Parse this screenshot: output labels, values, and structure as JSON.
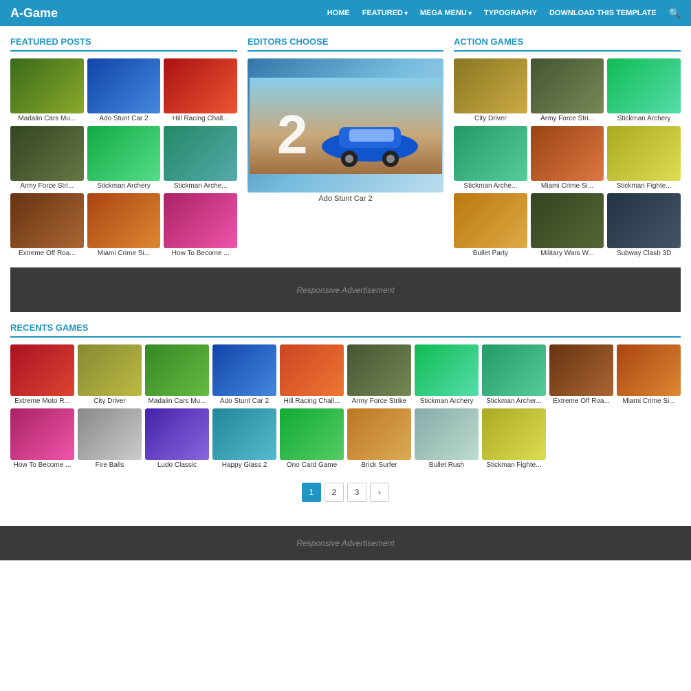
{
  "header": {
    "logo": "A-Game",
    "nav": [
      {
        "label": "HOME",
        "hasArrow": false
      },
      {
        "label": "FEATURED",
        "hasArrow": true
      },
      {
        "label": "MEGA MENU",
        "hasArrow": true
      },
      {
        "label": "TYPOGRAPHY",
        "hasArrow": false
      },
      {
        "label": "DOWNLOAD THIS TEMPLATE",
        "hasArrow": false
      }
    ]
  },
  "featured": {
    "title": "FEATURED POSTS",
    "games": [
      {
        "label": "Madalin Cars Mu...",
        "color": "#5a8a2a"
      },
      {
        "label": "Ado Stunt Car 2",
        "color": "#2266bb"
      },
      {
        "label": "Hill Racing Chall...",
        "color": "#cc3333"
      },
      {
        "label": "Army Force Stri...",
        "color": "#556644"
      },
      {
        "label": "Stickman Archery",
        "color": "#33bb66"
      },
      {
        "label": "Stickman Arche...",
        "color": "#44aa88"
      },
      {
        "label": "Extreme Off Roa...",
        "color": "#884422"
      },
      {
        "label": "Miami Crime Si...",
        "color": "#cc6633"
      },
      {
        "label": "How To Become ...",
        "color": "#cc4488"
      }
    ]
  },
  "editors": {
    "title": "EDITORS CHOOSE",
    "main_label": "Ado Stunt Car 2",
    "main_color": "#5599cc"
  },
  "action": {
    "title": "ACTION GAMES",
    "games": [
      {
        "label": "City Driver",
        "color": "#aa8833"
      },
      {
        "label": "Army Force Stri...",
        "color": "#667755"
      },
      {
        "label": "Stickman Archery",
        "color": "#33cc88"
      },
      {
        "label": "Stickman Arche...",
        "color": "#33aa77"
      },
      {
        "label": "Miami Crime Si...",
        "color": "#bb5522"
      },
      {
        "label": "Stickman Fighte...",
        "color": "#ccaa44"
      },
      {
        "label": "Bullet Party",
        "color": "#cc8833"
      },
      {
        "label": "Military Wars W...",
        "color": "#446633"
      },
      {
        "label": "Subway Clash 3D",
        "color": "#334455"
      }
    ]
  },
  "ad1": "Responsive Advertisement",
  "recents": {
    "title": "RECENTS GAMES",
    "row1": [
      {
        "label": "Extreme Moto R...",
        "color": "#cc2233"
      },
      {
        "label": "City Driver",
        "color": "#aabb44"
      },
      {
        "label": "Madalin Cars Mu...",
        "color": "#44aa33"
      },
      {
        "label": "Ado Stunt Car 2",
        "color": "#2266bb"
      },
      {
        "label": "Hill Racing Chall...",
        "color": "#cc4422"
      },
      {
        "label": "Army Force Strike",
        "color": "#667755"
      },
      {
        "label": "Stickman Archery",
        "color": "#33cc88"
      },
      {
        "label": "Stickman Archer...",
        "color": "#33aa77"
      },
      {
        "label": "Extreme Off Roa...",
        "color": "#884422"
      },
      {
        "label": "Miami Crime Si...",
        "color": "#cc6633"
      }
    ],
    "row2": [
      {
        "label": "How To Become ...",
        "color": "#cc4488"
      },
      {
        "label": "Fire Balls",
        "color": "#aaaaaa"
      },
      {
        "label": "Ludo Classic",
        "color": "#6644aa"
      },
      {
        "label": "Happy Glass 2",
        "color": "#44aabb"
      },
      {
        "label": "Ono Card Game",
        "color": "#22aa44"
      },
      {
        "label": "Brick Surfer",
        "color": "#cc8833"
      },
      {
        "label": "Bullet Rush",
        "color": "#aaccaa"
      },
      {
        "label": "Stickman Fighte...",
        "color": "#ccaa44"
      }
    ]
  },
  "pagination": {
    "pages": [
      "1",
      "2",
      "3"
    ],
    "next": "›"
  },
  "ad2": "Responsive Advertisement"
}
